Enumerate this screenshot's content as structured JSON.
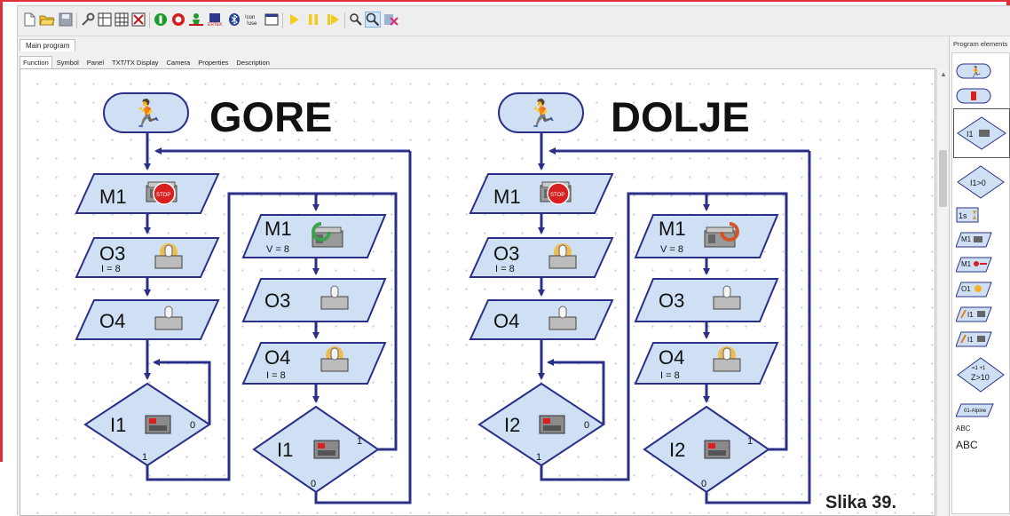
{
  "toolbar": {
    "buttons": [
      "new-file",
      "open-folder",
      "save",
      "settings",
      "io-panel",
      "grid",
      "delete-element",
      "run-online",
      "stop",
      "download",
      "compile",
      "bluetooth",
      "connect",
      "window",
      "start",
      "pause",
      "step",
      "zoom-out",
      "zoom-in",
      "remove-element"
    ]
  },
  "document": {
    "tab": "Main program"
  },
  "subtabs": [
    "Function",
    "Symbol",
    "Panel",
    "TXT/TX Display",
    "Camera",
    "Properties",
    "Description"
  ],
  "palette": {
    "title": "Program elements",
    "items": [
      "start",
      "end",
      "branch-I1",
      "compare-I1>0",
      "wait-1s",
      "motor-M1",
      "motor-M1-encoder",
      "output-O1",
      "input-I1",
      "counter-I1",
      "loop-Z>10",
      "subprogram",
      "text-abc-small",
      "text-abc-large"
    ],
    "branch": "I1",
    "compare": "I1>0",
    "wait": "1s",
    "motor": "M1",
    "motor2": "M1",
    "output": "O1",
    "input": "I1",
    "counter": "I1",
    "loop": "Z>10",
    "loop_top": "=1 +1",
    "sub": "01-Alpine",
    "abc_small": "ABC",
    "abc_large": "ABC"
  },
  "programs": [
    {
      "title": "GORE",
      "blocks": {
        "stop": "M1",
        "o3": "O3",
        "o3_val": "I = 8",
        "o4": "O4",
        "wait_input": "I1",
        "wait_zero": "0",
        "wait_one": "1",
        "run": "M1",
        "run_val": "V = 8",
        "run_o3": "O3",
        "run_o4": "O4",
        "run_o4_val": "I = 8",
        "stop_input": "I1",
        "stop_one": "1",
        "stop_zero": "0"
      }
    },
    {
      "title": "DOLJE",
      "blocks": {
        "stop": "M1",
        "o3": "O3",
        "o3_val": "I = 8",
        "o4": "O4",
        "wait_input": "I2",
        "wait_zero": "0",
        "wait_one": "1",
        "run": "M1",
        "run_val": "V = 8",
        "run_o3": "O3",
        "run_o4": "O4",
        "run_o4_val": "I = 8",
        "stop_input": "I2",
        "stop_one": "1",
        "stop_zero": "0"
      }
    }
  ],
  "caption": "Slika 39.",
  "colors": {
    "flow_line": "#2b2f88",
    "block_fill": "#cfe0f4",
    "block_stroke": "#2b2f88",
    "start_green": "#1e9a2a",
    "frame_red": "#e0303a",
    "stop_red": "#d82020",
    "lamp_glow": "#f5b428"
  }
}
